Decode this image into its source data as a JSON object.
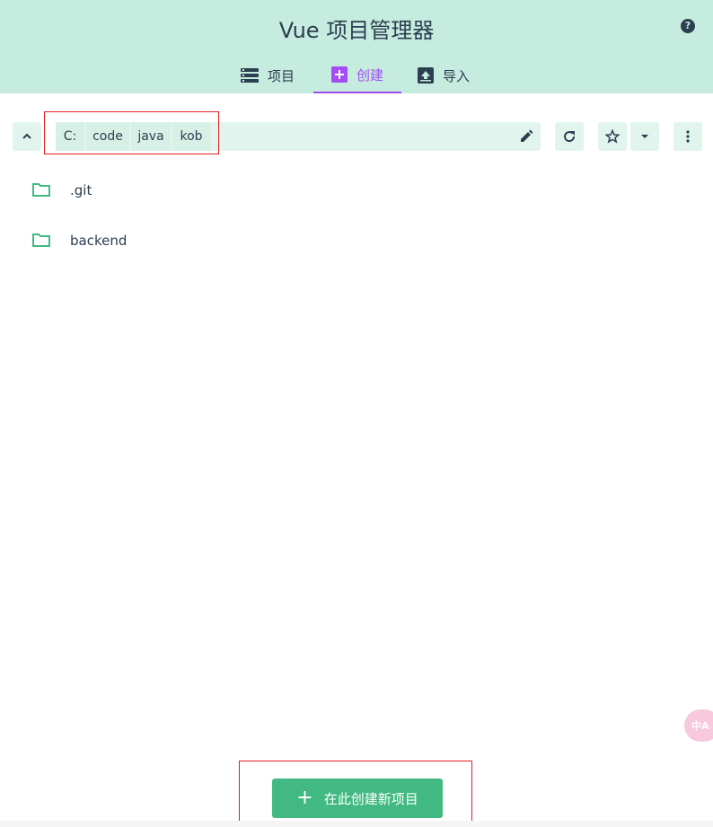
{
  "app": {
    "title": "Vue 项目管理器"
  },
  "tabs": [
    {
      "label": "项目",
      "icon": "list-icon"
    },
    {
      "label": "创建",
      "icon": "add-box-icon",
      "active": true
    },
    {
      "label": "导入",
      "icon": "import-icon"
    }
  ],
  "breadcrumbs": [
    "C:",
    "code",
    "java",
    "kob"
  ],
  "folders": [
    {
      "name": ".git",
      "icon": "folder-icon"
    },
    {
      "name": "backend",
      "icon": "folder-icon"
    }
  ],
  "create_button": {
    "label": "在此创建新项目"
  },
  "translate_badge": {
    "text": "中A"
  },
  "colors": {
    "header_bg": "#c6ebdf",
    "accent": "#a44cf6",
    "primary": "#42b983",
    "toolbar_bg": "#e1f5ee",
    "highlight": "#e02020",
    "text": "#2c3e50"
  }
}
